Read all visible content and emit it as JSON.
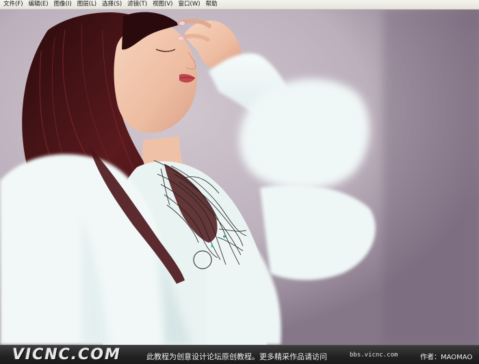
{
  "menu": {
    "items": [
      {
        "label": "文件",
        "key": "(F)"
      },
      {
        "label": "编辑",
        "key": "(E)"
      },
      {
        "label": "图像",
        "key": "(I)"
      },
      {
        "label": "图层",
        "key": "(L)"
      },
      {
        "label": "选择",
        "key": "(S)"
      },
      {
        "label": "滤镜",
        "key": "(T)"
      },
      {
        "label": "视图",
        "key": "(V)"
      },
      {
        "label": "窗口",
        "key": "(W)"
      },
      {
        "label": "帮助",
        "key": ""
      }
    ]
  },
  "banner": {
    "logo": "VICNC.COM",
    "tagline": "此教程为创意设计论坛原创教程。更多精采作品请访问",
    "site": "bbs.vicnc.com",
    "author": "作者：MAOMAO"
  },
  "colors": {
    "menu_bg": "#ece9d8",
    "background": "#b9aebb",
    "sweater": "#eef6f6",
    "hair": "#4a1416",
    "skin": "#f3c9b0",
    "path_anchor": "#2bb3a0"
  }
}
